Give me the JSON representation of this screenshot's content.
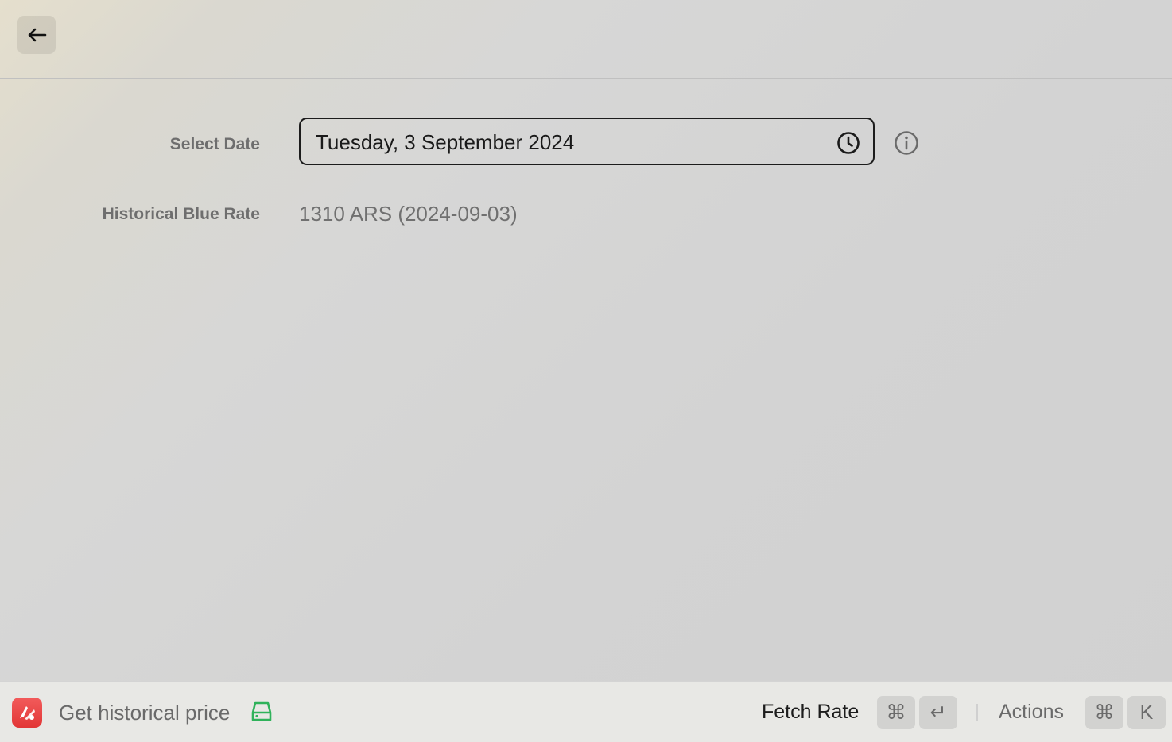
{
  "header": {
    "back_icon": "arrow-left-icon"
  },
  "form": {
    "date_label": "Select Date",
    "date_value": "Tuesday, 3 September 2024",
    "date_icon": "clock-icon",
    "info_icon": "info-icon",
    "rate_label": "Historical Blue Rate",
    "rate_value": "1310 ARS (2024-09-03)"
  },
  "footer": {
    "app_icon": "extension-icon",
    "app_icon_color": "#e9393c",
    "command_title": "Get historical price",
    "status_icon": "hard-drive-icon",
    "status_icon_color": "#2fb25a",
    "primary_action": "Fetch Rate",
    "primary_shortcut": [
      "⌘",
      "↵"
    ],
    "secondary_action": "Actions",
    "secondary_shortcut": [
      "⌘",
      "K"
    ]
  }
}
